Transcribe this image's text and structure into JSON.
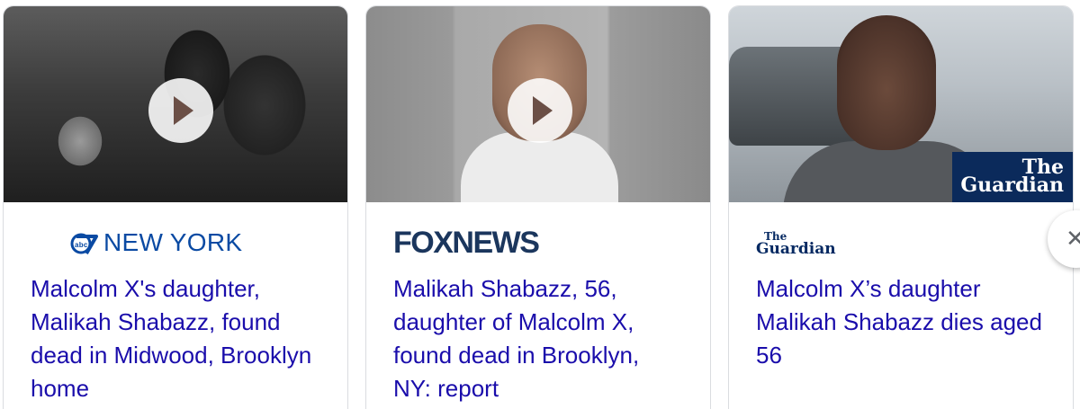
{
  "cards": [
    {
      "source": "NEW YORK",
      "headline": "Malcolm X's daughter, Malikah Shabazz, found dead in Midwood, Brooklyn home",
      "has_video": true
    },
    {
      "source": "FOXNEWS",
      "headline": "Malikah Shabazz, 56, daughter of Malcolm X, found dead in Brooklyn, NY: report",
      "has_video": true
    },
    {
      "source_line1": "The",
      "source_line2": "Guardian",
      "image_badge_line1": "The",
      "image_badge_line2": "Guardian",
      "headline": "Malcolm X’s daughter Malikah Shabazz dies aged 56",
      "has_video": false
    }
  ],
  "colors": {
    "headline_link": "#1a0dab",
    "abc_blue": "#0a4aa3",
    "fox_navy": "#1b365d",
    "guardian_navy": "#052962"
  },
  "icons": {
    "play": "play-icon",
    "next": "chevron-right-icon",
    "abc7": "abc7-logo-icon"
  }
}
